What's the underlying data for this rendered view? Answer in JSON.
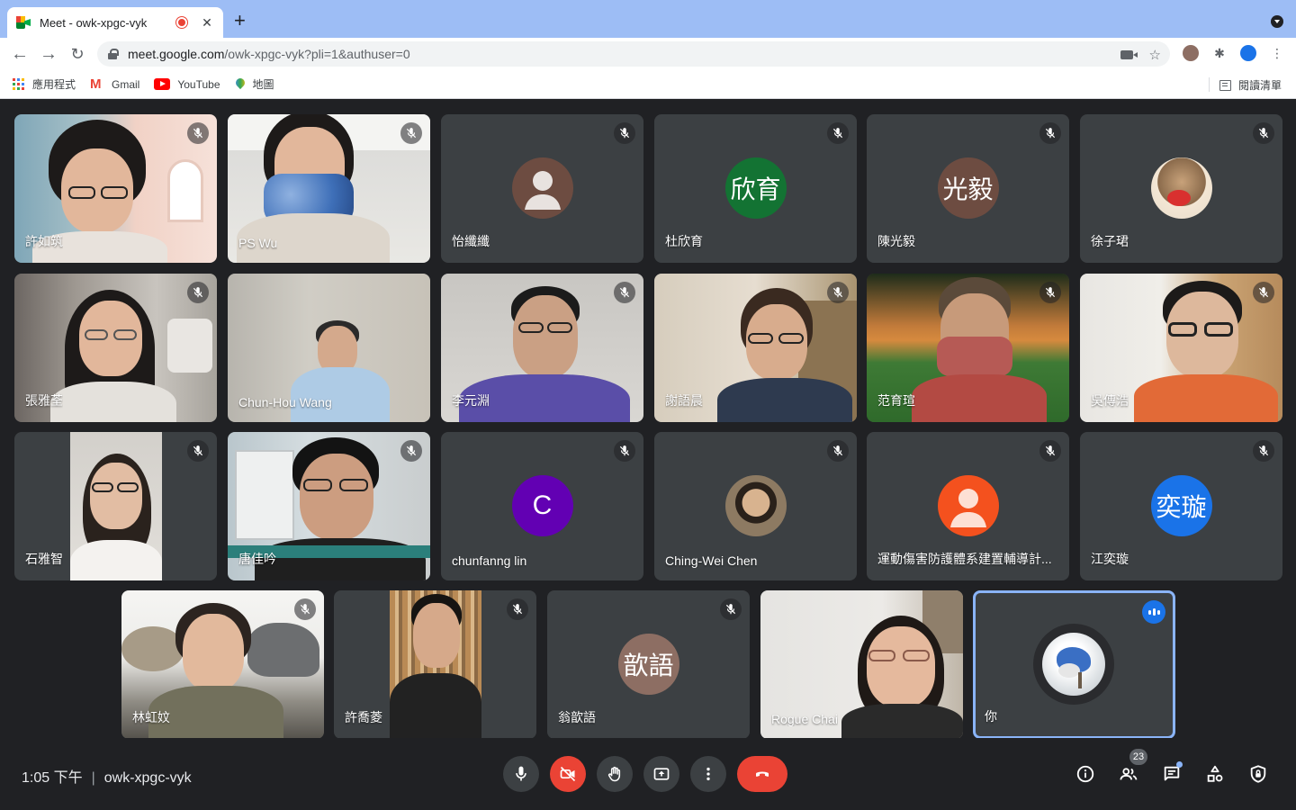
{
  "browser": {
    "tab_title": "Meet - owk-xpgc-vyk",
    "tab_close": "✕",
    "new_tab": "+",
    "url_host": "meet.google.com",
    "url_path": "/owk-xpgc-vyk?pli=1&authuser=0",
    "bookmarks": [
      {
        "label": "應用程式",
        "icon": "apps-grid-icon"
      },
      {
        "label": "Gmail",
        "icon": "gmail-icon"
      },
      {
        "label": "YouTube",
        "icon": "youtube-icon"
      },
      {
        "label": "地圖",
        "icon": "maps-icon"
      }
    ],
    "reading_list": "閱讀清單"
  },
  "participants": [
    {
      "name": "許如筑",
      "type": "video",
      "muted": true
    },
    {
      "name": "PS Wu",
      "type": "video",
      "muted": true
    },
    {
      "name": "怡纖纖",
      "type": "avatar",
      "avatar": "person",
      "avatar_color": "#6d4c41",
      "muted": true
    },
    {
      "name": "杜欣育",
      "type": "avatar",
      "avatar_text": "欣育",
      "avatar_color": "#137333",
      "muted": true
    },
    {
      "name": "陳光毅",
      "type": "avatar",
      "avatar_text": "光毅",
      "avatar_color": "#6d4c41",
      "muted": true
    },
    {
      "name": "徐子珺",
      "type": "avatar",
      "avatar": "photo",
      "muted": true
    },
    {
      "name": "張雅荃",
      "type": "video",
      "muted": true
    },
    {
      "name": "Chun-Hou Wang",
      "type": "video",
      "muted": false
    },
    {
      "name": "李元淵",
      "type": "video",
      "muted": true
    },
    {
      "name": "謝語晨",
      "type": "video",
      "muted": true
    },
    {
      "name": "范育瑄",
      "type": "video",
      "muted": true
    },
    {
      "name": "吳傳浩",
      "type": "video",
      "muted": true
    },
    {
      "name": "石雅智",
      "type": "video-narrow",
      "muted": true
    },
    {
      "name": "唐佳吟",
      "type": "video",
      "muted": true
    },
    {
      "name": "chunfanng lin",
      "type": "avatar",
      "avatar_text": "C",
      "avatar_color": "#6200b3",
      "muted": true
    },
    {
      "name": "Ching-Wei Chen",
      "type": "avatar",
      "avatar": "photo",
      "muted": true
    },
    {
      "name": "運動傷害防護體系建置輔導計...",
      "type": "avatar",
      "avatar": "person",
      "avatar_color": "#f4511e",
      "muted": true
    },
    {
      "name": "江奕璇",
      "type": "avatar",
      "avatar_text": "奕璇",
      "avatar_color": "#1a73e8",
      "muted": true
    },
    {
      "name": "林虹妏",
      "type": "video",
      "muted": true
    },
    {
      "name": "許喬菱",
      "type": "video-narrow",
      "muted": true
    },
    {
      "name": "翁歆語",
      "type": "avatar",
      "avatar_text": "歆語",
      "avatar_color": "#8d6e63",
      "muted": true
    },
    {
      "name": "Rogue Chai",
      "type": "video",
      "muted": false
    },
    {
      "name": "你",
      "type": "self",
      "muted": false
    }
  ],
  "bottom_bar": {
    "time": "1:05 下午",
    "separator": "|",
    "meeting_code": "owk-xpgc-vyk",
    "people_count": "23"
  },
  "colors": {
    "stage_bg": "#202124",
    "tile_bg": "#3c4043",
    "end_call": "#ea4335",
    "active_speaker_border": "#8ab4f8"
  }
}
